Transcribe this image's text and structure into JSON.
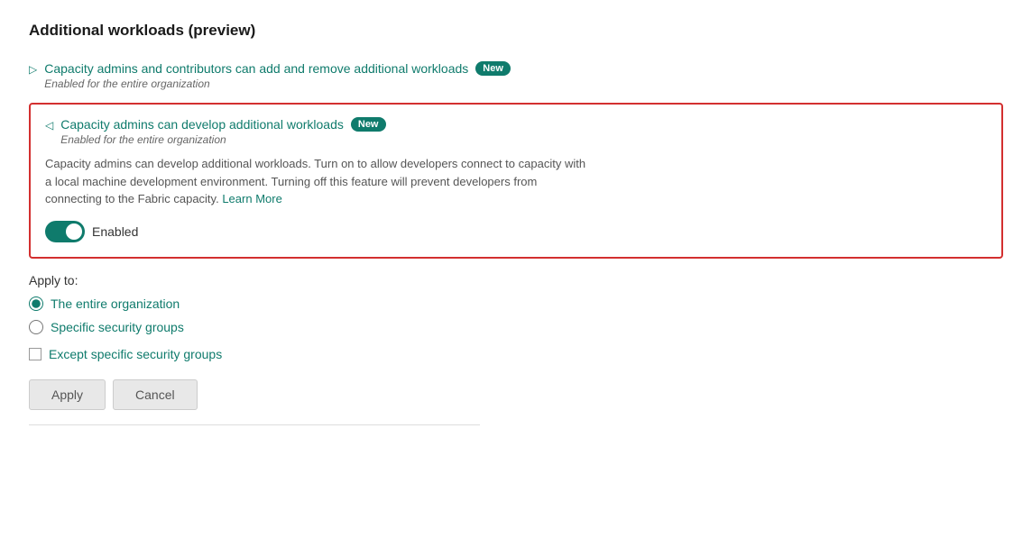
{
  "page": {
    "title": "Additional workloads (preview)"
  },
  "workloads": [
    {
      "id": "workload-1",
      "title": "Capacity admins and contributors can add and remove additional workloads",
      "badge": "New",
      "subtitle": "Enabled for the entire organization",
      "expanded": false,
      "arrow": "▷"
    },
    {
      "id": "workload-2",
      "title": "Capacity admins can develop additional workloads",
      "badge": "New",
      "subtitle": "Enabled for the entire organization",
      "expanded": true,
      "arrow": "◁",
      "description_part1": "Capacity admins can develop additional workloads. Turn on to allow developers connect to capacity with a local machine development environment. Turning off this feature will prevent developers from connecting to the Fabric capacity.",
      "learn_more_label": "Learn More",
      "toggle_enabled": true,
      "toggle_label": "Enabled"
    }
  ],
  "apply_to": {
    "title": "Apply to:",
    "options": [
      {
        "id": "entire-org",
        "label": "The entire organization",
        "selected": true
      },
      {
        "id": "specific-groups",
        "label": "Specific security groups",
        "selected": false
      }
    ],
    "except_label": "Except specific security groups"
  },
  "buttons": {
    "apply": "Apply",
    "cancel": "Cancel"
  },
  "icons": {
    "arrow_collapsed": "▷",
    "arrow_expanded": "◁"
  }
}
